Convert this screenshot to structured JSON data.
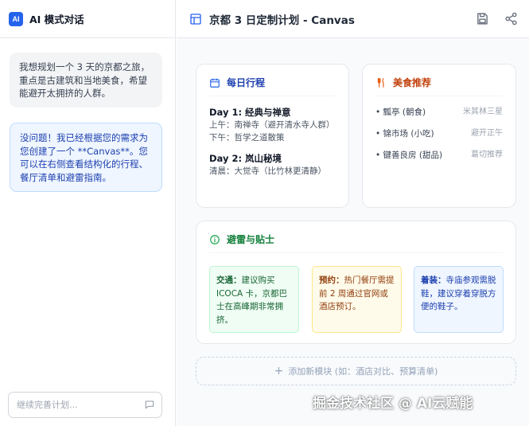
{
  "app": {
    "logo_text": "AI",
    "title": "AI 模式对话"
  },
  "chat": {
    "messages": [
      {
        "role": "user",
        "text": "我想规划一个 3 天的京都之旅，重点是古建筑和当地美食，希望能避开太拥挤的人群。"
      },
      {
        "role": "assistant",
        "text": "没问题！我已经根据您的需求为您创建了一个 **Canvas**。您可以在右侧查看结构化的行程、餐厅清单和避雷指南。"
      }
    ],
    "input_placeholder": "继续完善计划..."
  },
  "canvas": {
    "title": "京都 3 日定制计划 - Canvas",
    "schedule": {
      "heading": "每日行程",
      "days": [
        {
          "title": "Day 1: 经典与禅意",
          "lines": [
            "上午：南禅寺（避开清水寺人群）",
            "下午：哲学之道散策"
          ]
        },
        {
          "title": "Day 2: 岚山秘境",
          "lines": [
            "清晨：大觉寺（比竹林更清静）"
          ]
        }
      ]
    },
    "food": {
      "heading": "美食推荐",
      "items": [
        {
          "name": "• 瓢亭 (朝食)",
          "note": "米其林三星"
        },
        {
          "name": "• 锦市场 (小吃)",
          "note": "避开正午"
        },
        {
          "name": "• 键善良房 (甜品)",
          "note": "葛切推荐"
        }
      ]
    },
    "tips": {
      "heading": "避雷与贴士",
      "items": [
        {
          "label": "交通：",
          "text": "建议购买 ICOCA 卡，京都巴士在高峰期非常拥挤。"
        },
        {
          "label": "预约：",
          "text": "热门餐厅需提前 2 周通过官网或酒店预订。"
        },
        {
          "label": "着装：",
          "text": "寺庙参观需脱鞋，建议穿着穿脱方便的鞋子。"
        }
      ]
    },
    "add_module_label": "添加新模块 (如：酒店对比、预算清单)"
  },
  "watermark": "掘金技术社区 @ AI云赋能",
  "colors": {
    "accent": "#2563eb",
    "schedule": "#1e40af",
    "food": "#c2410c",
    "tips": "#15803d"
  },
  "icons": {
    "canvas": "layout-icon",
    "save": "save-icon",
    "share": "share-icon",
    "calendar": "calendar-icon",
    "food": "utensils-icon",
    "info": "info-icon",
    "send": "message-icon",
    "plus": "plus-icon"
  }
}
